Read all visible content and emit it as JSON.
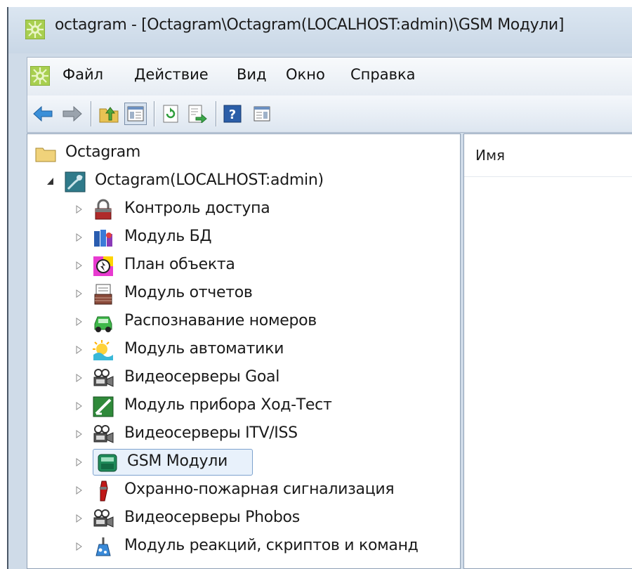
{
  "window": {
    "title": "octagram - [Octagram\\Octagram(LOCALHOST:admin)\\GSM Модули]"
  },
  "menu": {
    "items": [
      "Файл",
      "Действие",
      "Вид",
      "Окно",
      "Справка"
    ]
  },
  "toolbar": {
    "buttons": [
      "back-arrow-icon",
      "forward-arrow-icon",
      "up-folder-icon",
      "show-hide-console-tree-icon",
      "refresh-icon",
      "export-list-icon",
      "help-icon",
      "show-hide-action-pane-icon"
    ]
  },
  "list": {
    "column_name": "Имя"
  },
  "tree": {
    "root": "Octagram",
    "server": "Octagram(LOCALHOST:admin)",
    "items": [
      {
        "label": "Контроль доступа",
        "icon": "lock-icon"
      },
      {
        "label": "Модуль БД",
        "icon": "database-icon"
      },
      {
        "label": "План объекта",
        "icon": "floor-plan-icon"
      },
      {
        "label": "Модуль отчетов",
        "icon": "reports-icon"
      },
      {
        "label": "Распознавание номеров",
        "icon": "car-plate-icon"
      },
      {
        "label": "Модуль автоматики",
        "icon": "automation-icon"
      },
      {
        "label": "Видеосерверы Goal",
        "icon": "video-camera-icon"
      },
      {
        "label": "Модуль прибора Ход-Тест",
        "icon": "device-test-icon"
      },
      {
        "label": "Видеосерверы ITV/ISS",
        "icon": "video-camera-icon"
      },
      {
        "label": "GSM Модули",
        "icon": "gsm-module-icon"
      },
      {
        "label": "Охранно-пожарная сигнализация",
        "icon": "fire-alarm-icon"
      },
      {
        "label": "Видеосерверы Phobos",
        "icon": "video-camera-icon"
      },
      {
        "label": "Модуль реакций, скриптов и команд",
        "icon": "scripts-icon"
      }
    ],
    "selected_index": 9
  },
  "colors": {
    "title_bar": "#cfdbe8",
    "selection_border": "#7da2ce",
    "selection_fill": "#e8f1fb"
  }
}
